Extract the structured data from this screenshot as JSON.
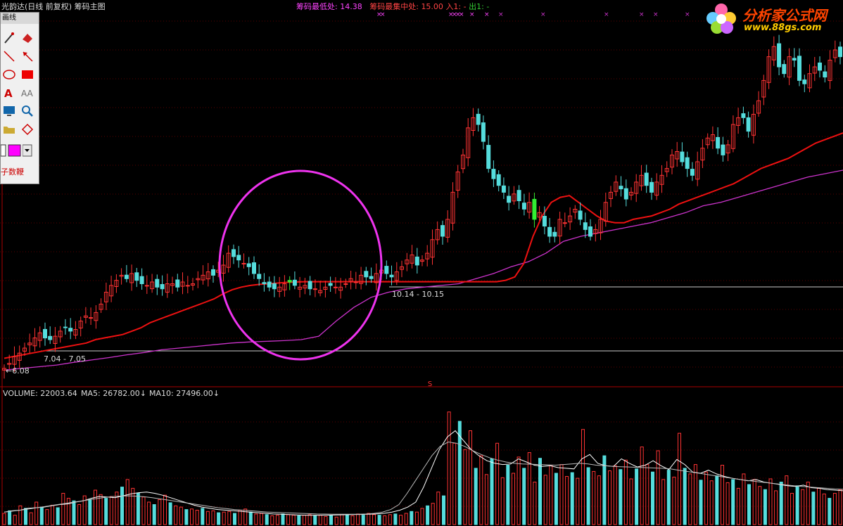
{
  "header": {
    "title": "光韵达(日线 前复权) 筹码主图",
    "low_label": "筹码最低处:",
    "low_value": "14.38",
    "concentration_label": "筹码最集中处:",
    "concentration_value": "15.00",
    "entry_label": "入1:",
    "entry_value": "-",
    "exit_label": "出1:",
    "exit_value": "-"
  },
  "toolbox": {
    "title": "画线",
    "footer": "子数鞭"
  },
  "logo": {
    "brand": "分析家公式网",
    "url": "www.88gs.com"
  },
  "annotations": {
    "price_min": "6.08",
    "range_1": "7.04 - 7.05",
    "range_2": "10.14 - 10.15",
    "s_marker": "S"
  },
  "volume": {
    "label": "VOLUME: 22003.64",
    "ma5": "MA5: 26782.00",
    "ma10": "MA10: 27496.00"
  },
  "colors": {
    "up": "#ff3333",
    "down": "#55dddd",
    "green": "#33ee33",
    "ma_red": "#ee1111",
    "ma_purple": "#cc33cc",
    "circle": "#ee33ee",
    "vol_ma": "#ffffff"
  },
  "chart_data": {
    "type": "candlestick",
    "price_ylim": [
      5.6,
      16.6
    ],
    "closes": [
      6.1,
      6.25,
      6.45,
      6.55,
      6.7,
      6.85,
      7.0,
      7.15,
      7.0,
      6.95,
      7.05,
      7.2,
      7.3,
      7.2,
      7.25,
      7.5,
      7.65,
      7.6,
      7.75,
      8.0,
      8.35,
      8.55,
      8.7,
      8.85,
      8.75,
      8.9,
      8.7,
      8.6,
      8.55,
      8.65,
      8.5,
      8.45,
      8.6,
      8.6,
      8.5,
      8.65,
      8.55,
      8.6,
      8.75,
      8.85,
      8.95,
      8.85,
      9.0,
      9.15,
      9.5,
      9.4,
      9.3,
      9.2,
      9.1,
      8.9,
      8.75,
      8.6,
      8.5,
      8.45,
      8.5,
      8.6,
      8.65,
      8.55,
      8.5,
      8.55,
      8.45,
      8.45,
      8.4,
      8.5,
      8.55,
      8.5,
      8.5,
      8.6,
      8.75,
      8.65,
      8.85,
      8.8,
      8.75,
      8.9,
      9.0,
      8.9,
      8.8,
      8.95,
      9.1,
      9.3,
      9.45,
      9.15,
      9.3,
      9.5,
      9.9,
      10.2,
      10.0,
      10.5,
      11.3,
      11.9,
      12.4,
      13.2,
      13.5,
      13.3,
      12.8,
      12.0,
      11.7,
      11.5,
      11.3,
      11.0,
      11.25,
      11.05,
      10.8,
      11.0,
      10.5,
      10.7,
      10.3,
      10.0,
      10.0,
      10.5,
      10.4,
      10.6,
      10.8,
      10.5,
      10.2,
      10.0,
      10.2,
      10.5,
      11.0,
      11.3,
      11.6,
      11.4,
      11.1,
      11.3,
      11.6,
      11.8,
      11.5,
      11.3,
      11.6,
      11.8,
      12.0,
      12.4,
      12.5,
      12.2,
      12.0,
      11.8,
      12.2,
      12.6,
      12.9,
      13.0,
      12.6,
      12.4,
      12.7,
      13.3,
      13.5,
      13.5,
      13.1,
      13.6,
      14.0,
      14.6,
      15.3,
      15.6,
      15.0,
      14.8,
      15.3,
      15.2,
      14.6,
      14.5,
      14.8,
      15.0,
      14.9,
      14.7,
      15.2,
      15.5,
      15.3
    ],
    "ma_red": [
      6.4,
      6.45,
      6.5,
      6.55,
      6.6,
      6.65,
      6.7,
      6.75,
      6.8,
      6.85,
      6.95,
      7.0,
      7.05,
      7.1,
      7.2,
      7.3,
      7.45,
      7.55,
      7.65,
      7.75,
      7.85,
      7.95,
      8.05,
      8.15,
      8.3,
      8.42,
      8.5,
      8.55,
      8.58,
      8.6,
      8.62,
      8.64,
      8.65,
      8.66,
      8.66,
      8.66,
      8.66,
      8.66,
      8.66,
      8.66,
      8.66,
      8.66,
      8.66,
      8.66,
      8.66,
      8.66,
      8.66,
      8.66,
      8.66,
      8.66,
      8.66,
      8.66,
      8.66,
      8.66,
      8.66,
      8.7,
      8.8,
      9.2,
      10.0,
      10.6,
      11.0,
      11.15,
      11.2,
      11.0,
      10.8,
      10.6,
      10.45,
      10.4,
      10.4,
      10.5,
      10.55,
      10.6,
      10.7,
      10.8,
      10.95,
      11.05,
      11.15,
      11.25,
      11.35,
      11.45,
      11.55,
      11.7,
      11.85,
      12.0,
      12.1,
      12.2,
      12.3,
      12.45,
      12.6,
      12.75,
      12.85,
      12.95,
      13.05
    ],
    "ma_purple": [
      6.05,
      6.1,
      6.15,
      6.2,
      6.28,
      6.35,
      6.42,
      6.5,
      6.57,
      6.65,
      6.7,
      6.75,
      6.8,
      6.85,
      6.88,
      6.9,
      6.92,
      6.95,
      7.05,
      7.5,
      7.9,
      8.2,
      8.35,
      8.45,
      8.5,
      8.55,
      8.6,
      8.75,
      8.9,
      9.1,
      9.25,
      9.5,
      9.85,
      10.0,
      10.1,
      10.2,
      10.3,
      10.4,
      10.55,
      10.7,
      10.9,
      11.0,
      11.15,
      11.3,
      11.45,
      11.6,
      11.75,
      11.85,
      11.95
    ],
    "vol_ylim": [
      0,
      20000
    ],
    "volume": [
      1800,
      2200,
      1500,
      3000,
      2600,
      1900,
      3600,
      2800,
      2400,
      3100,
      2700,
      5000,
      4200,
      3800,
      3200,
      4600,
      4000,
      5500,
      4800,
      4200,
      4500,
      5200,
      6000,
      7200,
      5800,
      5000,
      4400,
      3600,
      3200,
      4000,
      4700,
      3500,
      3000,
      2800,
      2400,
      2500,
      2300,
      2600,
      2100,
      2200,
      1900,
      2000,
      2100,
      1800,
      2300,
      2500,
      2000,
      1700,
      1800,
      1600,
      1400,
      1500,
      1700,
      1600,
      1500,
      1400,
      1500,
      1600,
      1400,
      1500,
      1300,
      1400,
      1200,
      1600,
      1500,
      1400,
      1700,
      1500,
      1800,
      1600,
      1500,
      1400,
      1600,
      1700,
      1500,
      1800,
      2100,
      2000,
      2600,
      3000,
      3400,
      5200,
      4600,
      18000,
      13000,
      16500,
      12000,
      15000,
      9000,
      11000,
      8000,
      10500,
      13000,
      7500,
      9500,
      8200,
      10800,
      9000,
      11500,
      6800,
      10600,
      7900,
      9400,
      8200,
      9600,
      7700,
      8300,
      7400,
      15200,
      9100,
      8500,
      7800,
      11000,
      8600,
      9400,
      8800,
      10300,
      7300,
      8900,
      12400,
      9600,
      8400,
      11800,
      7200,
      8700,
      7600,
      14600,
      9000,
      8100,
      9600,
      7100,
      8400,
      7000,
      7800,
      9500,
      6700,
      7200,
      5800,
      8100,
      6400,
      7200,
      6100,
      5600,
      7300,
      5400,
      6800,
      7800,
      5000,
      6200,
      5600,
      6800,
      5200,
      5800,
      4900,
      4200,
      5000,
      5600
    ],
    "vol_ma5": [
      2000,
      2200,
      2300,
      2600,
      2700,
      2800,
      3000,
      3200,
      3300,
      3600,
      3800,
      4200,
      4500,
      4400,
      4300,
      4600,
      4900,
      5100,
      5200,
      5000,
      4700,
      4300,
      3900,
      3500,
      3100,
      2800,
      2600,
      2400,
      2300,
      2200,
      2100,
      2000,
      1900,
      1800,
      1700,
      1650,
      1600,
      1550,
      1500,
      1480,
      1500,
      1520,
      1550,
      1570,
      1600,
      1620,
      1650,
      1700,
      1800,
      2000,
      2300,
      2800,
      3600,
      6000,
      9000,
      12000,
      14000,
      15000,
      13500,
      12000,
      11000,
      10200,
      9800,
      9600,
      9700,
      10500,
      10000,
      9500,
      9300,
      9400,
      9100,
      9000,
      8900,
      10500,
      11200,
      9800,
      9400,
      9300,
      10500,
      9800,
      9200,
      9500,
      10200,
      9400,
      8800,
      10400,
      9600,
      8400,
      8200,
      8700,
      8100,
      7700,
      7400,
      7200,
      7000,
      7200,
      6800,
      6600,
      6400,
      6200,
      6100,
      6300,
      5900,
      5800,
      5600,
      5500,
      5400
    ],
    "vol_ma10": [
      2000,
      2150,
      2300,
      2500,
      2700,
      2900,
      3100,
      3300,
      3500,
      3700,
      3900,
      4100,
      4300,
      4450,
      4550,
      4600,
      4550,
      4450,
      4300,
      4100,
      3900,
      3700,
      3500,
      3300,
      3100,
      2900,
      2700,
      2550,
      2400,
      2300,
      2200,
      2100,
      2000,
      1950,
      1900,
      1850,
      1800,
      1750,
      1700,
      1680,
      1660,
      1650,
      1650,
      1660,
      1700,
      1800,
      2000,
      2400,
      3200,
      5000,
      7000,
      9000,
      11000,
      12500,
      13200,
      13000,
      12500,
      11800,
      11200,
      10700,
      10300,
      10000,
      9800,
      9700,
      9650,
      9600,
      9550,
      9500,
      9600,
      9700,
      9800,
      9700,
      9500,
      9400,
      9300,
      9250,
      9200,
      9150,
      9100,
      9050,
      9000,
      8900,
      8700,
      8500,
      8300,
      8100,
      7900,
      7700,
      7500,
      7300,
      7100,
      6950,
      6800,
      6650,
      6500,
      6350,
      6200,
      6100,
      6000,
      5900,
      5800,
      5700,
      5650
    ]
  }
}
